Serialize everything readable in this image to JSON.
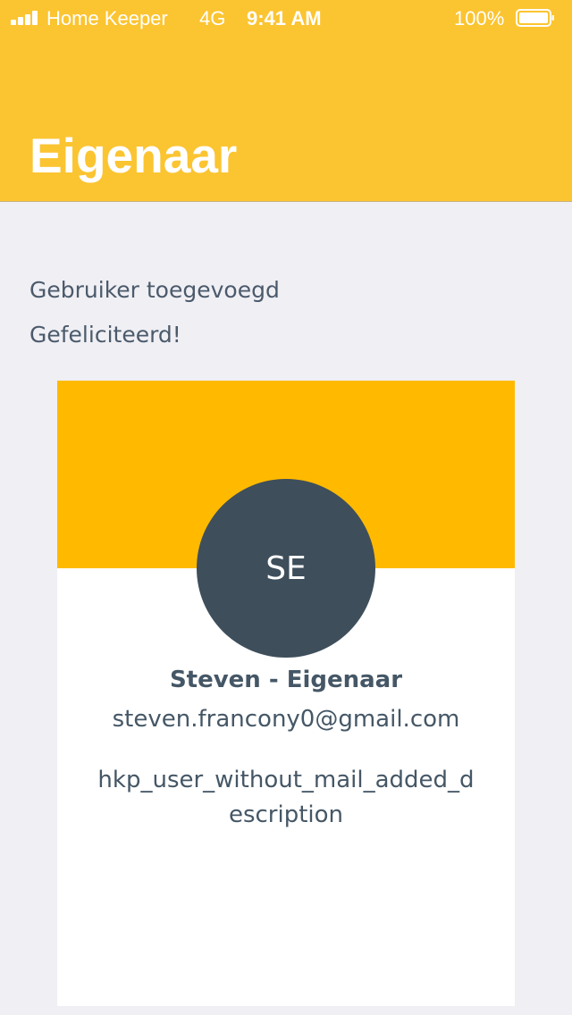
{
  "status_bar": {
    "carrier": "Home Keeper",
    "network": "4G",
    "time": "9:41 AM",
    "battery": "100%",
    "icons": [
      "signal-icon",
      "battery-icon"
    ]
  },
  "header": {
    "title": "Eigenaar",
    "background_color": "#fbc431"
  },
  "messages": {
    "line1": "Gebruiker toegevoegd",
    "line2": "Gefeliciteerd!"
  },
  "user_card": {
    "banner_color": "#ffba00",
    "avatar_initials": "SE",
    "avatar_color": "#3e4e5b",
    "name": "Steven - Eigenaar",
    "email": "steven.francony0@gmail.com",
    "description": "hkp_user_without_mail_added_description"
  }
}
